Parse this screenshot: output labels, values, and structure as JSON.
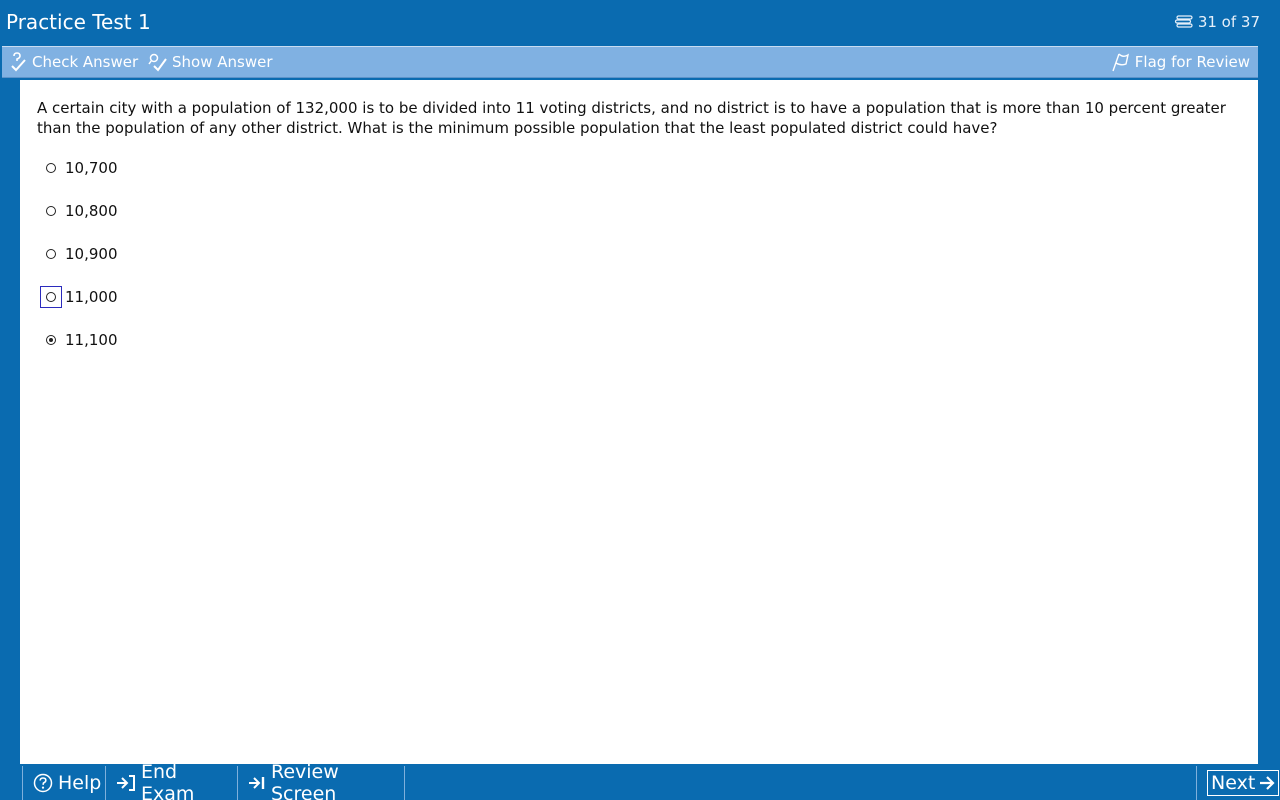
{
  "header": {
    "title": "Practice Test 1",
    "counter": "31 of 37"
  },
  "toolbar": {
    "check_answer": "Check Answer",
    "show_answer": "Show Answer",
    "flag_for_review": "Flag for Review"
  },
  "question": {
    "text": "A certain city with a population of 132,000 is to be divided into 11 voting districts, and no district is to have a population that is more than 10 percent greater than the population of any other district.  What is the minimum possible population that the least populated district could have?",
    "choices": [
      {
        "label": "10,700",
        "selected": false,
        "focused": false
      },
      {
        "label": "10,800",
        "selected": false,
        "focused": false
      },
      {
        "label": "10,900",
        "selected": false,
        "focused": false
      },
      {
        "label": "11,000",
        "selected": false,
        "focused": true
      },
      {
        "label": "11,100",
        "selected": true,
        "focused": false
      }
    ]
  },
  "footer": {
    "help": "Help",
    "end_exam": "End Exam",
    "review_screen": "Review Screen",
    "next": "Next"
  },
  "icons": {
    "counter": "stacked-pages-icon",
    "check": "check-answer-icon",
    "show": "show-answer-icon",
    "flag": "flag-icon",
    "help": "question-circle-icon",
    "end": "end-exam-arrow-icon",
    "review": "review-arrow-icon",
    "next": "next-arrow-icon"
  },
  "colors": {
    "frame_blue": "#0a6bb0",
    "toolbar_blue": "#80b1e2",
    "focus_border": "#2b2bbd"
  }
}
